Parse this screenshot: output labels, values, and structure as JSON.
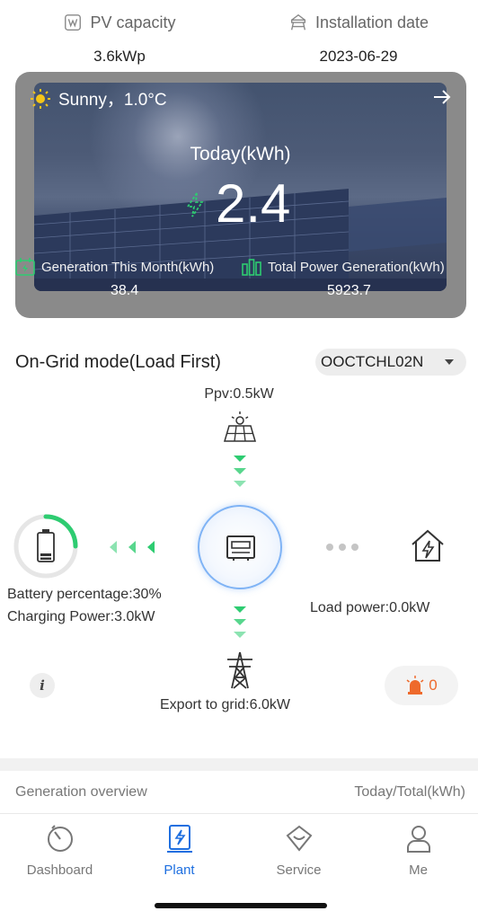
{
  "header": {
    "pv_capacity_label": "PV capacity",
    "pv_capacity_value": "3.6kWp",
    "install_date_label": "Installation date",
    "install_date_value": "2023-06-29"
  },
  "weather_card": {
    "weather_text": "Sunny，1.0°C",
    "today_label": "Today(kWh)",
    "today_value": "2.4",
    "month_label": "Generation This Month(kWh)",
    "month_value": "38.4",
    "total_label": "Total Power Generation(kWh)",
    "total_value": "5923.7"
  },
  "mode": {
    "title": "On-Grid mode(Load First)",
    "device_id": "OOCTCHL02N"
  },
  "flow": {
    "ppv": "Ppv:0.5kW",
    "battery_percentage_label": "Battery percentage:30%",
    "battery_percentage": 30,
    "charging_power_label": "Charging Power:3.0kW",
    "load_power_label": "Load power:0.0kW",
    "export_label": "Export to grid:6.0kW",
    "alarm_count": "0"
  },
  "overview": {
    "title": "Generation overview",
    "unit": "Today/Total(kWh)"
  },
  "tabbar": {
    "tabs": [
      {
        "label": "Dashboard",
        "icon": "dashboard-icon"
      },
      {
        "label": "Plant",
        "icon": "plant-icon"
      },
      {
        "label": "Service",
        "icon": "service-icon"
      },
      {
        "label": "Me",
        "icon": "me-icon"
      }
    ],
    "active": "Plant"
  },
  "colors": {
    "accent_blue": "#1e6fe0",
    "flow_green": "#2ecc71",
    "alarm_orange": "#ee6a2c"
  }
}
